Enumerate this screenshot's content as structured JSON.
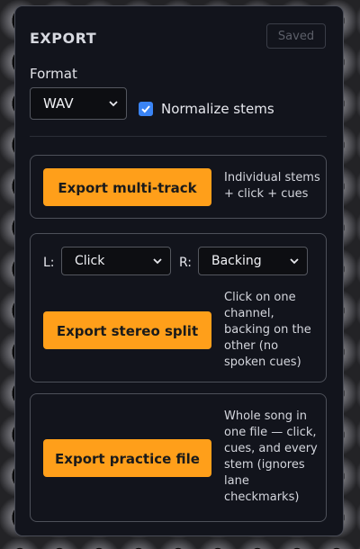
{
  "panel": {
    "title": "EXPORT",
    "saved_label": "Saved"
  },
  "format": {
    "label": "Format",
    "selected": "WAV",
    "normalize_label": "Normalize stems",
    "normalize_checked": true
  },
  "multitrack": {
    "button_label": "Export multi-track",
    "description_lines": [
      "Individual stems",
      "+ click + cues"
    ]
  },
  "stereo": {
    "left_label": "L:",
    "left_value": "Click",
    "right_label": "R:",
    "right_value": "Backing",
    "button_label": "Export stereo split",
    "description_lines": [
      "Click on one",
      "channel,",
      "backing on the",
      "other (no",
      "spoken cues)"
    ]
  },
  "practice": {
    "button_label": "Export practice file",
    "description_lines": [
      "Whole song in",
      "one file — click,",
      "cues, and every",
      "stem (ignores",
      "lane",
      "checkmarks)"
    ]
  },
  "colors": {
    "accent": "#ff9f1a",
    "checkbox": "#3a84f5",
    "panel_bg": "#12141c"
  }
}
